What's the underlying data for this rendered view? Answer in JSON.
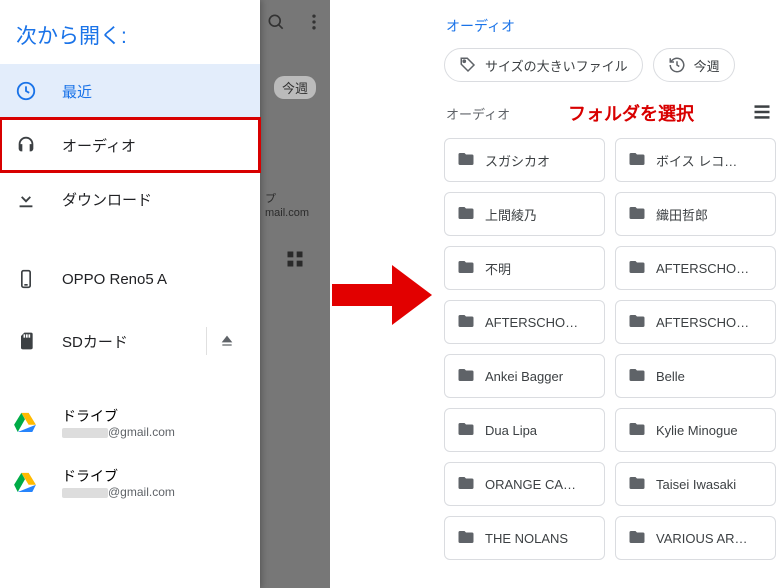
{
  "drawer": {
    "title": "次から開く:",
    "items": [
      {
        "icon": "clock-icon",
        "label": "最近",
        "selected": true
      },
      {
        "icon": "headphones-icon",
        "label": "オーディオ",
        "highlight": true
      },
      {
        "icon": "download-icon",
        "label": "ダウンロード"
      }
    ],
    "storage": [
      {
        "icon": "phone-icon",
        "label": "OPPO Reno5 A"
      },
      {
        "icon": "sd-icon",
        "label": "SDカード",
        "eject": true
      }
    ],
    "accounts": [
      {
        "label": "ドライブ",
        "email_suffix": "@gmail.com"
      },
      {
        "label": "ドライブ",
        "email_suffix": "@gmail.com"
      }
    ]
  },
  "backdrop": {
    "chip": "今週",
    "account_line1": "プ",
    "account_line2": "mail.com"
  },
  "right": {
    "breadcrumb": "オーディオ",
    "chips": [
      {
        "icon": "tag-icon",
        "label": "サイズの大きいファイル"
      },
      {
        "icon": "history-icon",
        "label": "今週"
      }
    ],
    "section_label": "オーディオ",
    "callout": "フォルダを選択",
    "folders": [
      "スガシカオ",
      "ボイス レコ…",
      "上間綾乃",
      "織田哲郎",
      "不明",
      "AFTERSCHO…",
      "AFTERSCHO…",
      "AFTERSCHO…",
      "Ankei Bagger",
      "Belle",
      "Dua Lipa",
      "Kylie Minogue",
      "ORANGE CA…",
      "Taisei Iwasaki",
      "THE NOLANS",
      "VARIOUS AR…"
    ]
  }
}
